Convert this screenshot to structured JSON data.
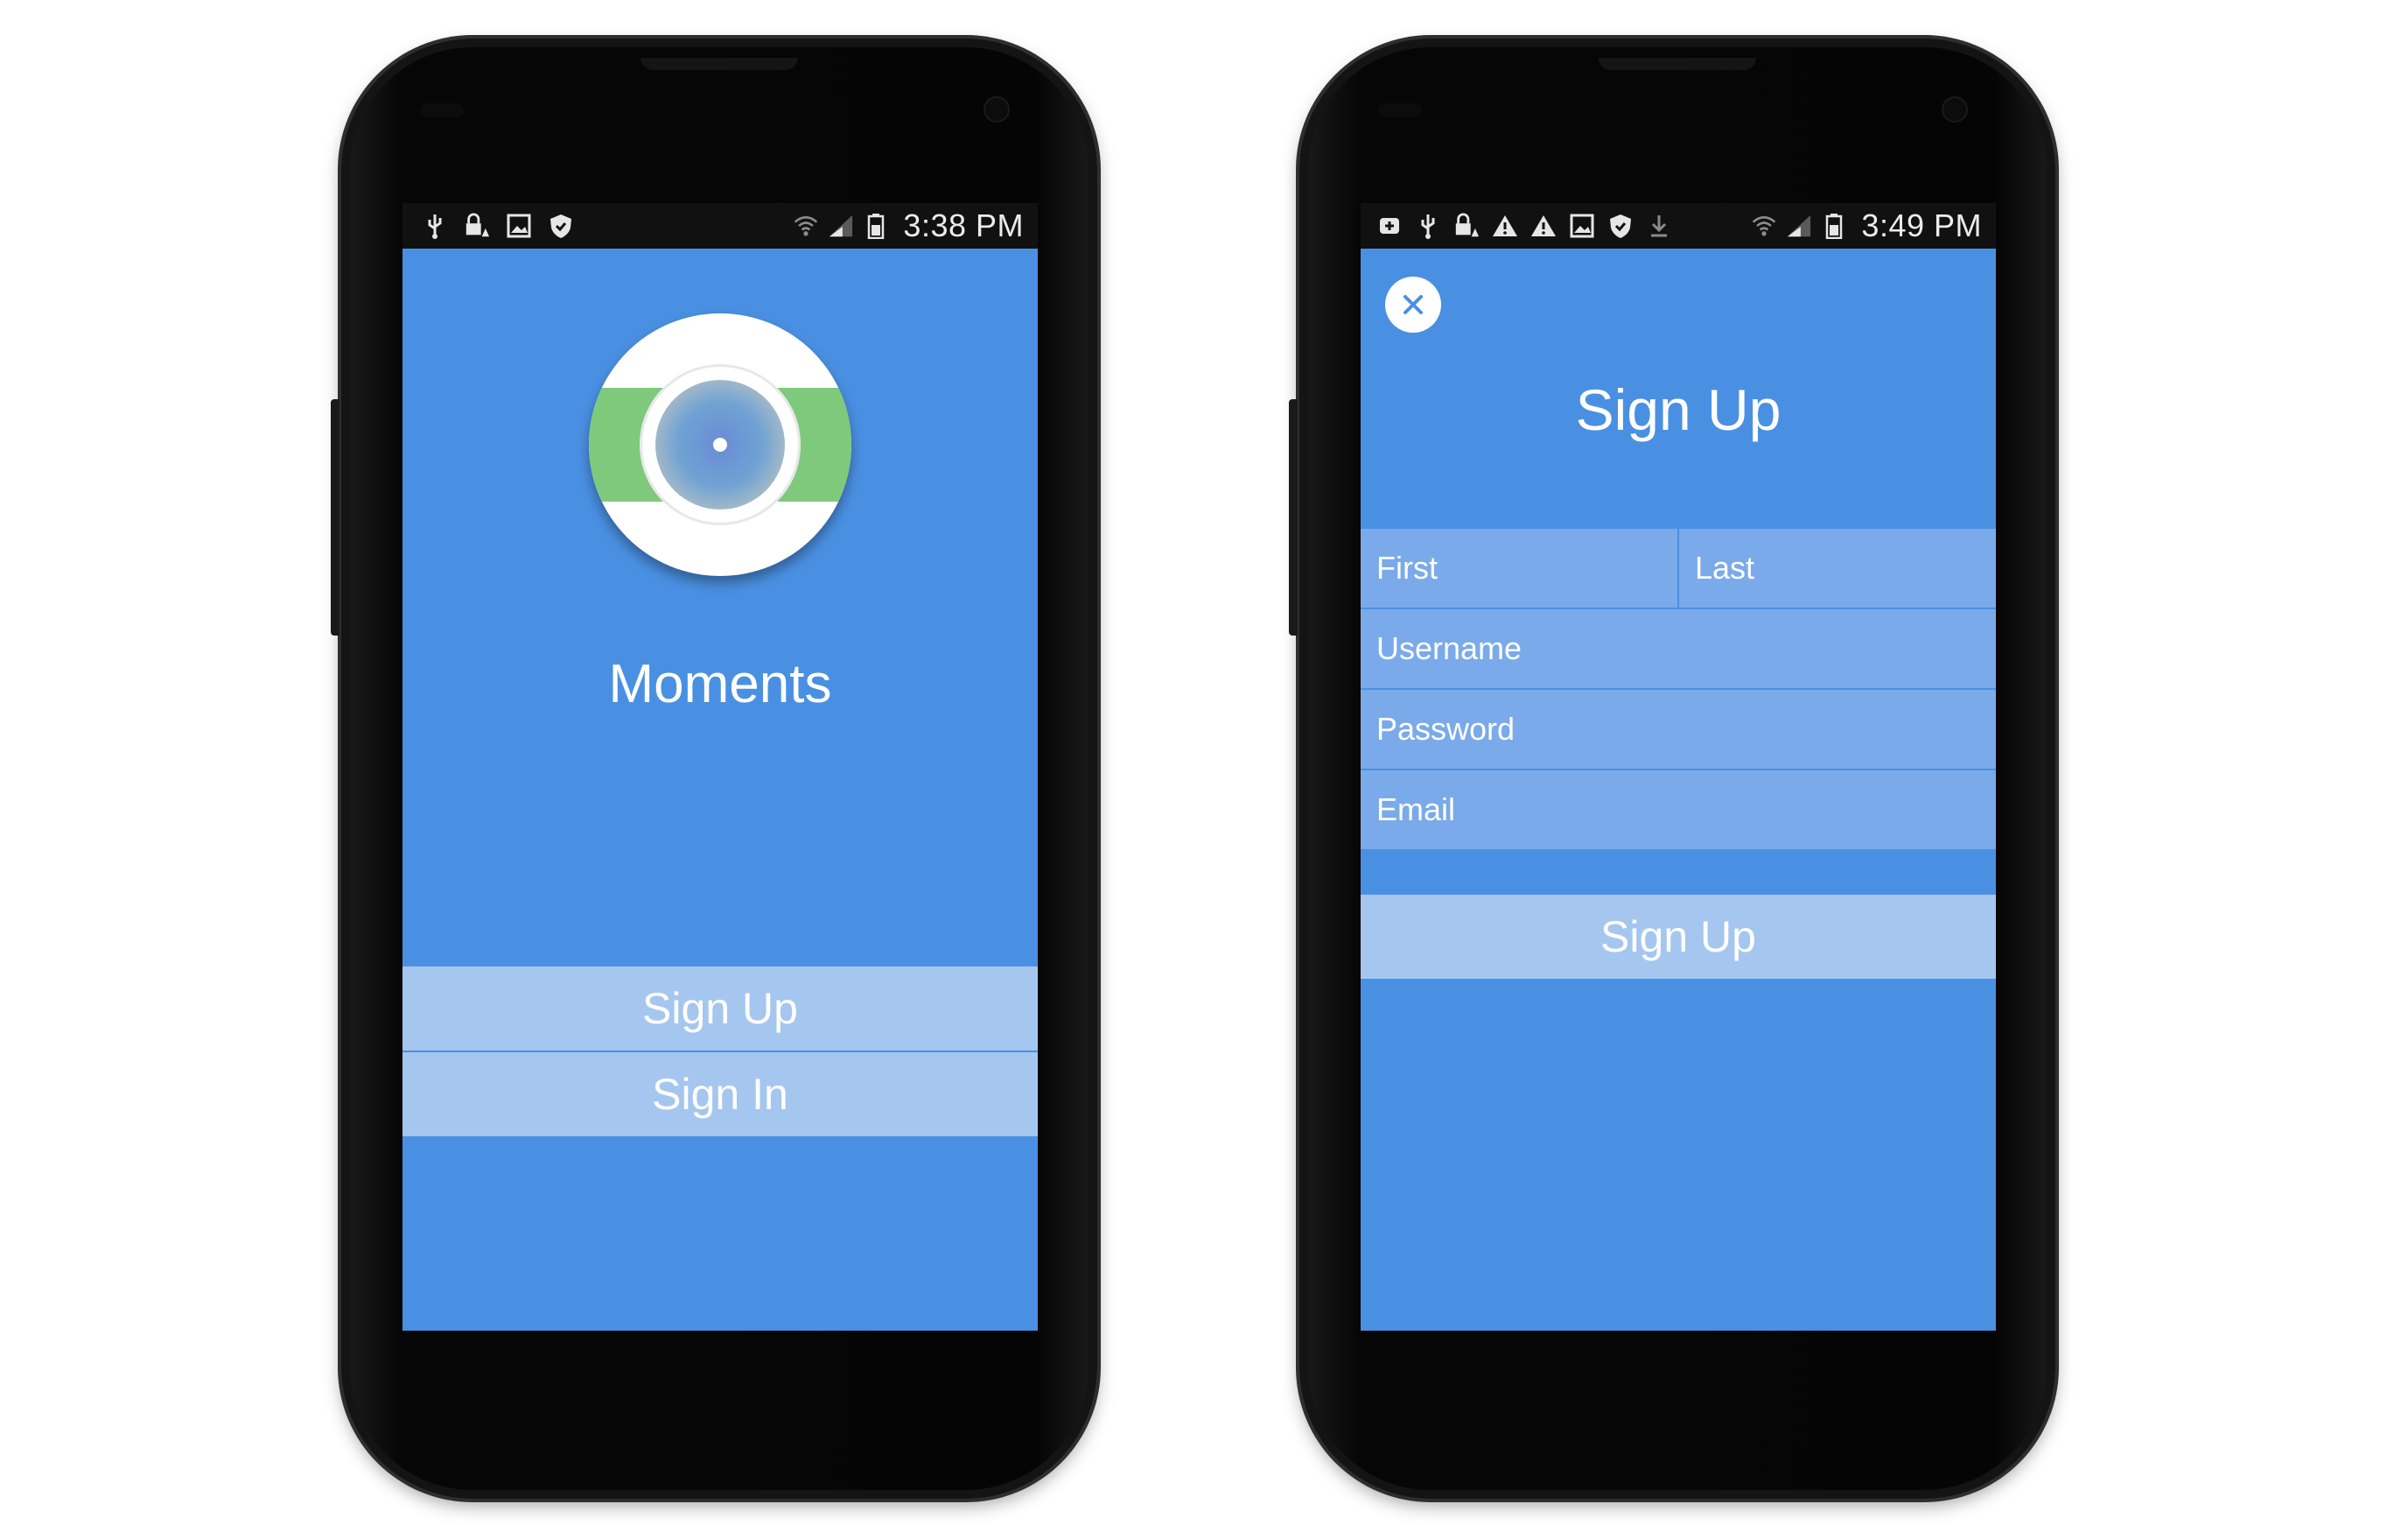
{
  "left_screen": {
    "statusbar": {
      "left_icons": [
        "usb-icon",
        "lock-warning-icon",
        "image-icon",
        "shield-icon"
      ],
      "right_icons": [
        "wifi-icon",
        "signal-icon",
        "battery-icon"
      ],
      "time": "3:38 PM"
    },
    "app_name": "Moments",
    "buttons": {
      "sign_up": "Sign Up",
      "sign_in": "Sign In"
    }
  },
  "right_screen": {
    "statusbar": {
      "left_icons": [
        "add-icon",
        "usb-icon",
        "lock-warning-icon",
        "warning-icon",
        "warning-icon",
        "image-icon",
        "shield-icon",
        "download-icon"
      ],
      "right_icons": [
        "wifi-icon",
        "signal-icon",
        "battery-icon"
      ],
      "time": "3:49 PM"
    },
    "title": "Sign Up",
    "form": {
      "first_placeholder": "First",
      "last_placeholder": "Last",
      "username_placeholder": "Username",
      "password_placeholder": "Password",
      "email_placeholder": "Email"
    },
    "submit_label": "Sign Up"
  },
  "colors": {
    "screen_background": "#4a90e2",
    "button_fill": "#a5c6ef",
    "field_fill": "#7aaae9",
    "logo_green": "#7fc97c"
  }
}
